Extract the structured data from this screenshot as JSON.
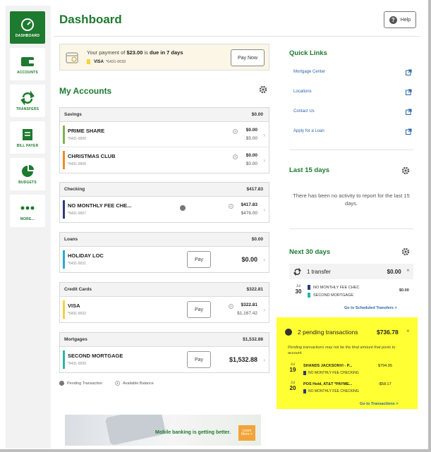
{
  "sidebar": {
    "items": [
      {
        "label": "DASHBOARD",
        "icon": "dashboard-icon",
        "active": true
      },
      {
        "label": "ACCOUNTS",
        "icon": "wallet-icon"
      },
      {
        "label": "TRANSFERS",
        "icon": "transfer-icon"
      },
      {
        "label": "BILL PAYER",
        "icon": "bill-payer-icon"
      },
      {
        "label": "BUDGETS",
        "icon": "pie-chart-icon"
      },
      {
        "label": "MORE...",
        "icon": "more-icon"
      }
    ]
  },
  "header": {
    "title": "Dashboard",
    "help_label": "Help"
  },
  "alert": {
    "prefix": "Your payment of ",
    "amount": "$23.00",
    "middle": " is ",
    "due": "due in 7 days",
    "card_name": "VISA",
    "card_number": "*6431-0032",
    "pay_now_label": "Pay Now"
  },
  "accounts": {
    "title": "My Accounts",
    "groups": [
      {
        "name": "Savings",
        "total": "$0.00",
        "rows": [
          {
            "name": "PRIME SHARE",
            "acct": "*6431-0000",
            "v1": "$0.00",
            "v2": "$5.00",
            "color": "#7fb24d"
          },
          {
            "name": "CHRISTMAS CLUB",
            "acct": "*6431-0009",
            "v1": "$0.00",
            "v2": "$0.00",
            "color": "#f08a24"
          }
        ]
      },
      {
        "name": "Checking",
        "total": "$417.83",
        "rows": [
          {
            "name": "NO MONTHLY FEE CHE...",
            "acct": "*6431-0007",
            "v1": "$417.83",
            "v2": "$476.00",
            "color": "#2e3a7e"
          }
        ]
      },
      {
        "name": "Loans",
        "total": "$0.00",
        "rows": [
          {
            "name": "HOLIDAY LOC",
            "acct": "*6431-0031",
            "big": "$0.00",
            "pay": "Pay",
            "color": "#2aa8d8"
          }
        ]
      },
      {
        "name": "Credit Cards",
        "total": "$322.81",
        "rows": [
          {
            "name": "VISA",
            "acct": "*6431-0032",
            "v1": "$322.81",
            "v2": "$1,167.42",
            "pay": "Pay",
            "color": "#f4d23c"
          }
        ]
      },
      {
        "name": "Mortgages",
        "total": "$1,532.88",
        "rows": [
          {
            "name": "SECOND MORTGAGE",
            "acct": "*6431-0039",
            "big": "$1,532.88",
            "pay": "Pay",
            "color": "#2bb5a8"
          }
        ]
      }
    ],
    "legend_pending": "Pending Transaction",
    "legend_available": "Available Balance"
  },
  "promo": {
    "text": "Mobile banking is getting better.",
    "cta": "Learn More >"
  },
  "quick_links": {
    "title": "Quick Links",
    "items": [
      "Mortgage Center",
      "Locations",
      "Contact Us",
      "Apply for a Loan"
    ]
  },
  "last": {
    "prefix": "Last ",
    "days": "15",
    "suffix": " days",
    "message": "There has been no activity to report for the last 15 days."
  },
  "next": {
    "prefix": "Next ",
    "days": "30",
    "suffix": " days",
    "transfer_count": "1 transfer",
    "transfer_total": "$0.00",
    "transfer_month": "Jul",
    "transfer_day": "30",
    "from": "NO MONTHLY FEE CHEC",
    "to": "SECOND MORTGAGE",
    "transfer_amount": "$0.00",
    "link": "Go to Scheduled Transfers >"
  },
  "pending": {
    "title": "2 pending transactions",
    "total": "$736.78",
    "note": "Pending transactions may not be the final amount that posts to account.",
    "items": [
      {
        "month": "Jul",
        "day": "19",
        "desc": "SHANDS JACKSONVI - P...",
        "amount": "$794.95",
        "account": "NO MONTHLY FEE CHECKING"
      },
      {
        "month": "Jul",
        "day": "20",
        "desc": "POS Hold, AT&T *PAYME...",
        "amount": "-$58.17",
        "account": "NO MONTHLY FEE CHECKING"
      }
    ],
    "link": "Go to Transactions >"
  },
  "colors": {
    "brand": "#1d7a2e",
    "highlight": "#ffff33",
    "link": "#2a64a8"
  }
}
